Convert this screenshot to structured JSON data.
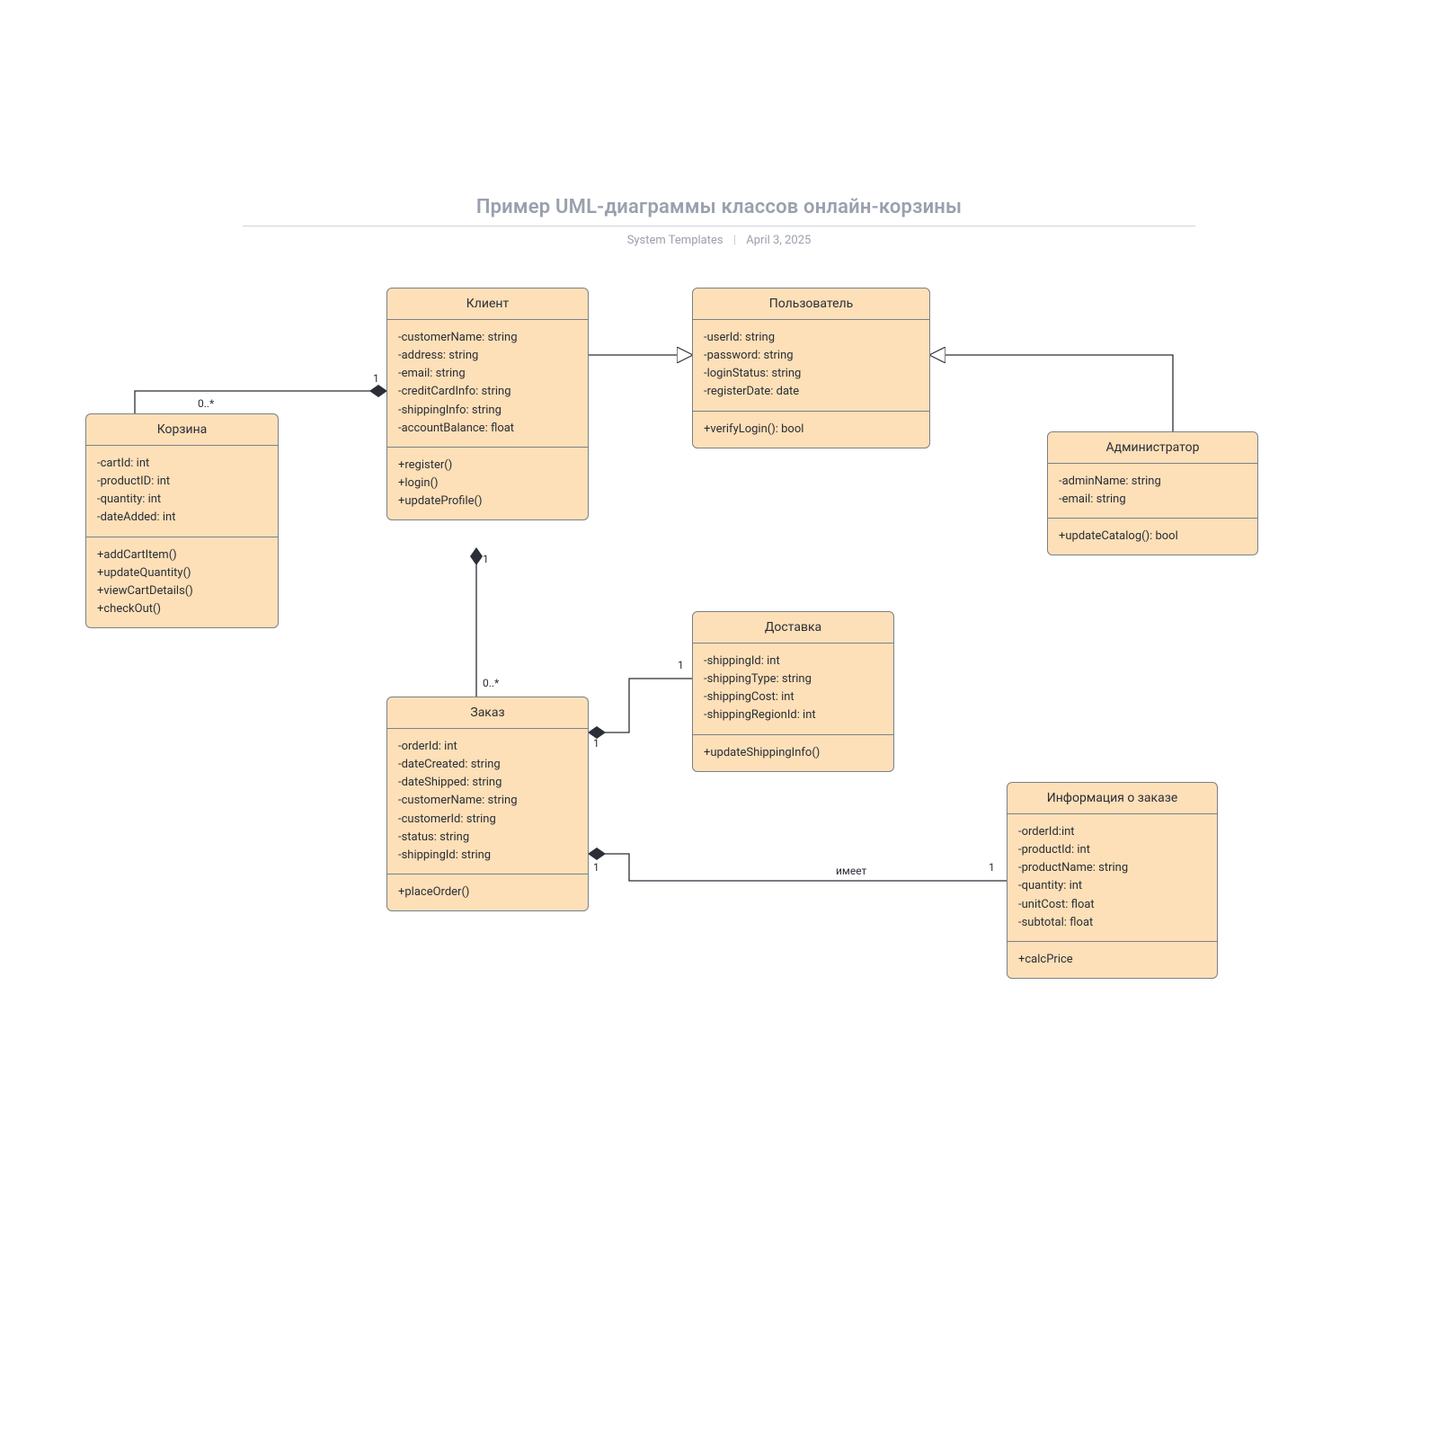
{
  "header": {
    "title": "Пример UML-диаграммы классов онлайн-корзины",
    "subtitle1": "System Templates",
    "subtitle2": "April 3, 2025"
  },
  "classes": {
    "korzina": {
      "name": "Корзина",
      "attrs": [
        "-cartId: int",
        "-productID: int",
        "-quantity: int",
        "-dateAdded: int"
      ],
      "methods": [
        "+addCartItem()",
        "+updateQuantity()",
        "+viewCartDetails()",
        "+checkOut()"
      ]
    },
    "klient": {
      "name": "Клиент",
      "attrs": [
        "-customerName: string",
        "-address: string",
        "-email: string",
        "-creditCardInfo: string",
        "-shippingInfo: string",
        "-accountBalance: float"
      ],
      "methods": [
        "+register()",
        "+login()",
        "+updateProfile()"
      ]
    },
    "user": {
      "name": "Пользователь",
      "attrs": [
        "-userId: string",
        "-password: string",
        "-loginStatus: string",
        "-registerDate: date"
      ],
      "methods": [
        "+verifyLogin(): bool"
      ]
    },
    "admin": {
      "name": "Администратор",
      "attrs": [
        "-adminName: string",
        "-email: string"
      ],
      "methods": [
        "+updateCatalog(): bool"
      ]
    },
    "zakaz": {
      "name": "Заказ",
      "attrs": [
        "-orderId: int",
        "-dateCreated: string",
        "-dateShipped: string",
        "-customerName: string",
        "-customerId: string",
        "-status: string",
        "-shippingId: string"
      ],
      "methods": [
        "+placeOrder()"
      ]
    },
    "dostavka": {
      "name": "Доставка",
      "attrs": [
        "-shippingId: int",
        "-shippingType: string",
        "-shippingCost: int",
        "-shippingRegionId: int"
      ],
      "methods": [
        "+updateShippingInfo()"
      ]
    },
    "orderinfo": {
      "name": "Информация о заказе",
      "attrs": [
        "-orderId:int",
        "-productId: int",
        "-productName: string",
        "-quantity: int",
        "-unitCost: float",
        "-subtotal: float"
      ],
      "methods": [
        "+calcPrice"
      ]
    }
  },
  "labels": {
    "korzina_mult": "0..*",
    "klient_one_a": "1",
    "klient_one_b": "1",
    "zakaz_mult": "0..*",
    "zakaz_one_ship": "1",
    "ship_one": "1",
    "zakaz_one_info": "1",
    "info_one": "1",
    "edge_has": "имеет"
  }
}
